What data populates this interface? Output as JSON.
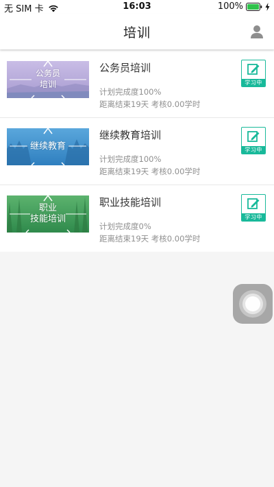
{
  "status_bar": {
    "carrier": "无 SIM 卡",
    "time": "16:03",
    "battery": "100%"
  },
  "header": {
    "title": "培训",
    "user_icon": "user-icon"
  },
  "courses": [
    {
      "thumb_lines": [
        "公务员",
        "培训"
      ],
      "thumb_color": "#b8a9d9",
      "title": "公务员培训",
      "progress": "计划完成度100%",
      "meta": "距离结束19天 考核0.00学时",
      "badge": "学习中"
    },
    {
      "thumb_lines": [
        "继续教育",
        ""
      ],
      "thumb_color": "#3e8cc7",
      "title": "继续教育培训",
      "progress": "计划完成度100%",
      "meta": "距离结束19天 考核0.00学时",
      "badge": "学习中"
    },
    {
      "thumb_lines": [
        "职业",
        "技能培训"
      ],
      "thumb_color": "#3e9a5c",
      "title": "职业技能培训",
      "progress": "计划完成度0%",
      "meta": "距离结束19天 考核0.00学时",
      "badge": "学习中"
    }
  ],
  "colors": {
    "accent": "#18b99a",
    "background": "#f5f5f5"
  }
}
